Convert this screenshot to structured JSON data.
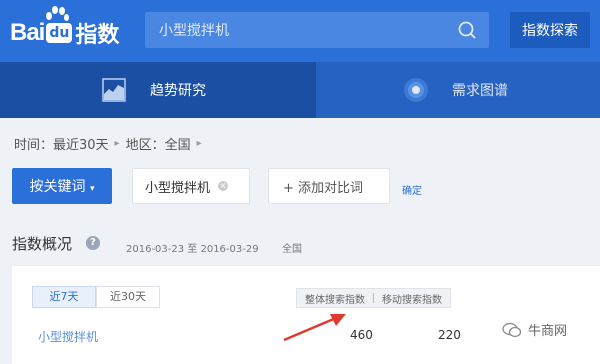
{
  "header": {
    "logo_bai": "Bai",
    "logo_du": "du",
    "logo_zhishu": "指数",
    "search_value": "小型搅拌机",
    "explore_label": "指数探索"
  },
  "tabs": [
    {
      "label": "趋势研究",
      "active": true
    },
    {
      "label": "需求图谱",
      "active": false
    }
  ],
  "filters": {
    "time": "时间：最近30天",
    "region": "地区：全国"
  },
  "keywords": {
    "by_keyword_label": "按关键词",
    "current": "小型搅拌机",
    "add_compare": "+ 添加对比词",
    "confirm": "确定"
  },
  "overview": {
    "title": "指数概况",
    "date_range": "2016-03-23 至 2016-03-29",
    "region": "全国",
    "period_tabs": [
      "近7天",
      "近30天"
    ],
    "col_overall": "整体搜索指数",
    "col_mobile": "移动搜索指数",
    "row_keyword": "小型搅拌机",
    "overall_value": "460",
    "mobile_value": "220"
  },
  "watermark": "牛商网",
  "colors": {
    "brand_blue": "#2b6fd9",
    "tab_active": "#1a4fa3",
    "arrow_red": "#e03a2e"
  }
}
